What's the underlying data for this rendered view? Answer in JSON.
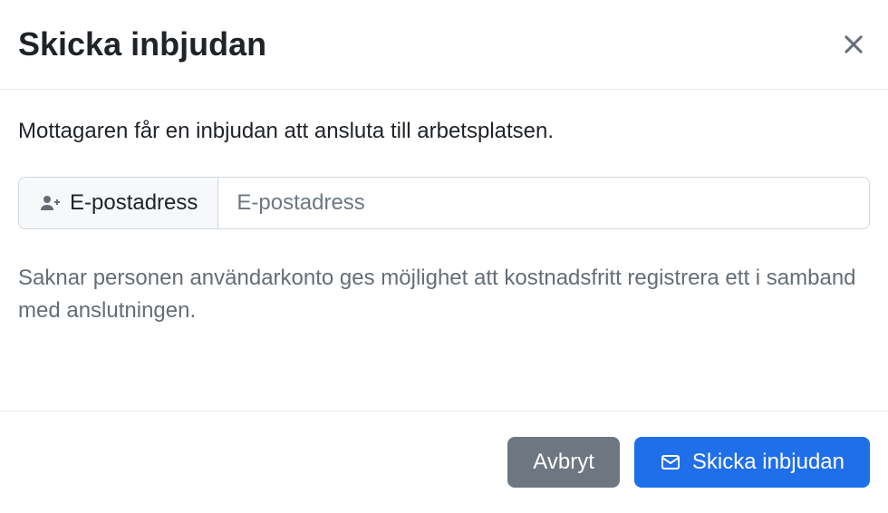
{
  "header": {
    "title": "Skicka inbjudan"
  },
  "body": {
    "description": "Mottagaren får en inbjudan att ansluta till arbetsplatsen.",
    "input_label": "E-postadress",
    "input_placeholder": "E-postadress",
    "helper_text": "Saknar personen användarkonto ges möjlighet att kostnadsfritt registrera ett i samband med anslutningen."
  },
  "footer": {
    "cancel_label": "Avbryt",
    "submit_label": "Skicka inbjudan"
  }
}
